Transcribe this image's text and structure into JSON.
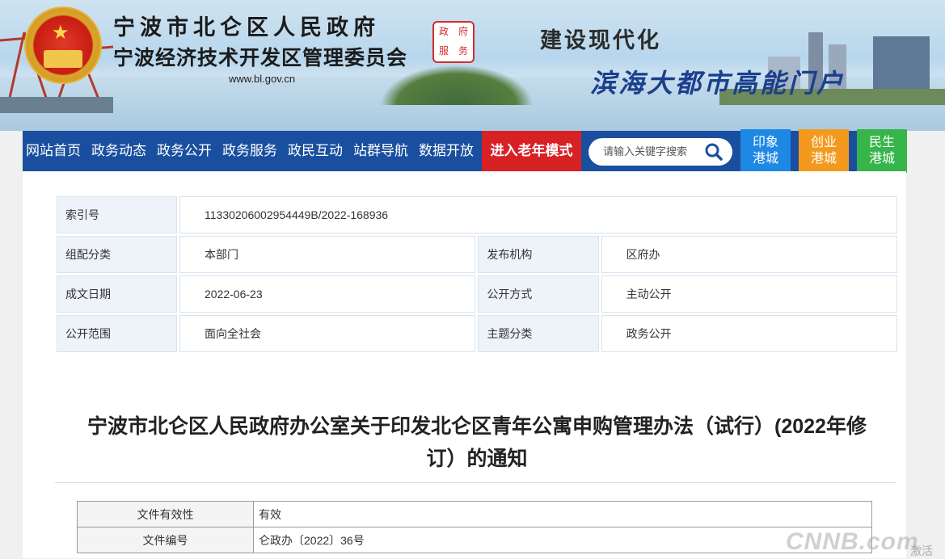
{
  "header": {
    "gov_name": "宁波市北仑区人民政府",
    "committee_name": "宁波经济技术开发区管理委员会",
    "url": "www.bl.gov.cn",
    "seal_chars": [
      "政",
      "府",
      "服",
      "务"
    ],
    "slogan_line1": "建设现代化",
    "slogan_line2": "滨海大都市高能门户"
  },
  "nav": {
    "items": [
      "网站首页",
      "政务动态",
      "政务公开",
      "政务服务",
      "政民互动",
      "站群导航",
      "数据开放"
    ],
    "elder_mode": "进入老年模式",
    "search_placeholder": "请输入关键字搜索",
    "tiles": [
      {
        "label": "印象港城",
        "line1": "印象",
        "line2": "港城",
        "color": "#1e88e5"
      },
      {
        "label": "创业港城",
        "line1": "创业",
        "line2": "港城",
        "color": "#f39a1e"
      },
      {
        "label": "民生港城",
        "line1": "民生",
        "line2": "港城",
        "color": "#35b54a"
      }
    ]
  },
  "meta": {
    "index_label": "索引号",
    "index_value": "11330206002954449B/2022-168936",
    "category_label": "组配分类",
    "category_value": "本部门",
    "publisher_label": "发布机构",
    "publisher_value": "区府办",
    "date_label": "成文日期",
    "date_value": "2022-06-23",
    "method_label": "公开方式",
    "method_value": "主动公开",
    "scope_label": "公开范围",
    "scope_value": "面向全社会",
    "topic_label": "主题分类",
    "topic_value": "政务公开"
  },
  "document": {
    "title_line1": "宁波市北仑区人民政府办公室关于印发北仑区青年公寓申购管理办法（试行）(2022年修",
    "title_line2": "订）的通知"
  },
  "info": {
    "validity_label": "文件有效性",
    "validity_value": "有效",
    "number_label": "文件编号",
    "number_value": "仑政办〔2022〕36号"
  },
  "watermark": {
    "brand": "CNNB.com",
    "sub": "激活"
  },
  "colors": {
    "nav_bg": "#1a4f9f",
    "elder_bg": "#d82125"
  }
}
